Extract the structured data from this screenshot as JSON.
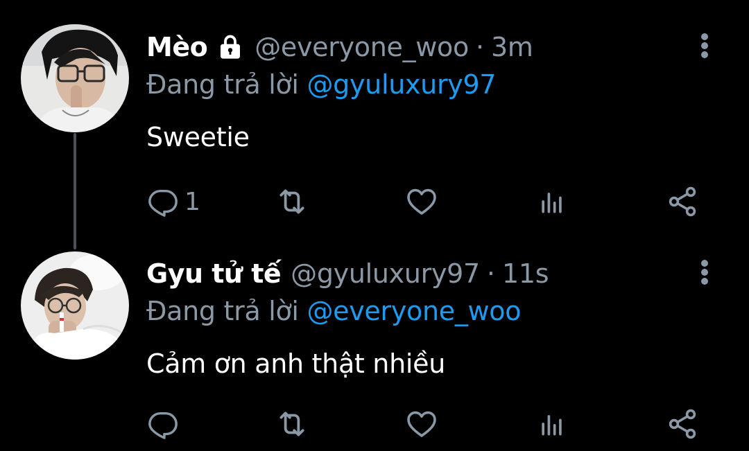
{
  "colors": {
    "background": "#000000",
    "text_primary": "#ffffff",
    "text_secondary": "#8b98a5",
    "mention_blue": "#1d9bf0",
    "thread_line": "#4a5059"
  },
  "tweets": [
    {
      "display_name": "Mèo",
      "protected_icon": "lock-icon",
      "handle": "@everyone_woo",
      "separator": "·",
      "time": "3m",
      "replying_prefix": "Đang trả lời",
      "replying_to": "@gyuluxury97",
      "text": "Sweetie",
      "actions": {
        "reply_icon": "reply-icon",
        "reply_count": "1",
        "retweet_icon": "retweet-icon",
        "like_icon": "heart-icon",
        "analytics_icon": "analytics-icon",
        "share_icon": "share-icon"
      }
    },
    {
      "display_name": "Gyu tử tế",
      "handle": "@gyuluxury97",
      "separator": "·",
      "time": "11s",
      "replying_prefix": "Đang trả lời",
      "replying_to": "@everyone_woo",
      "text": "Cảm ơn anh thật nhiều",
      "actions": {
        "reply_icon": "reply-icon",
        "reply_count": "",
        "retweet_icon": "retweet-icon",
        "like_icon": "heart-icon",
        "analytics_icon": "analytics-icon",
        "share_icon": "share-icon"
      }
    }
  ]
}
